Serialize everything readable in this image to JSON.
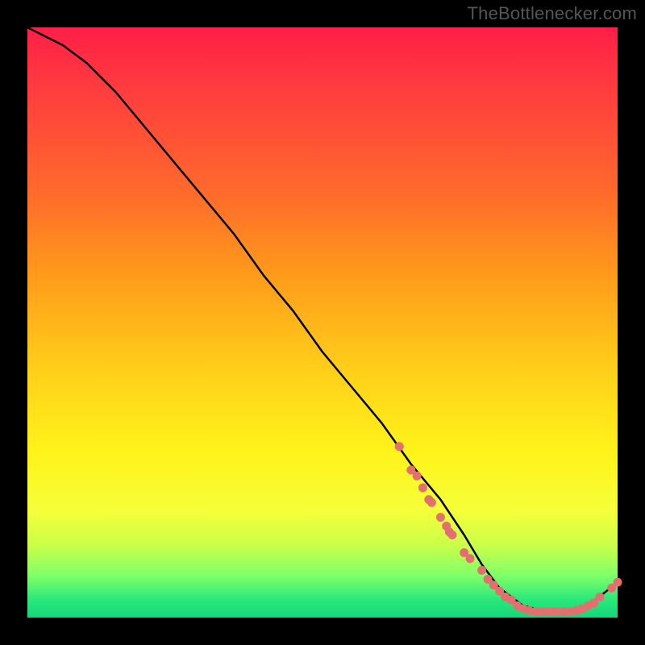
{
  "watermark": "TheBottlenecker.com",
  "chart_data": {
    "type": "line",
    "title": "",
    "xlabel": "",
    "ylabel": "",
    "xlim": [
      0,
      100
    ],
    "ylim": [
      0,
      100
    ],
    "series": [
      {
        "name": "curve",
        "x": [
          0,
          6,
          10,
          15,
          20,
          25,
          30,
          35,
          40,
          45,
          50,
          55,
          60,
          65,
          70,
          74,
          77,
          80,
          84,
          88,
          92,
          95,
          100
        ],
        "y": [
          100,
          97,
          94,
          89,
          83,
          77,
          71,
          65,
          58,
          52,
          45,
          39,
          33,
          26,
          20,
          14,
          9,
          5,
          2,
          1,
          1,
          2,
          6
        ]
      }
    ],
    "markers": {
      "name": "highlighted-points",
      "color": "#e36f6e",
      "x": [
        63,
        65,
        66,
        67,
        68,
        68.5,
        70,
        71,
        71.5,
        72,
        74,
        75,
        77,
        78,
        79,
        80,
        81,
        82,
        83,
        84,
        85,
        86,
        87,
        88,
        89,
        90,
        91,
        92,
        93,
        94,
        95,
        96,
        97,
        99,
        100
      ],
      "y": [
        29,
        25,
        24,
        22,
        20,
        19.5,
        17,
        15.5,
        14.5,
        14,
        11,
        10,
        8,
        6.5,
        5.5,
        4.5,
        3.5,
        3,
        2,
        1.5,
        1.2,
        1,
        1,
        1,
        1,
        1,
        1,
        1,
        1.2,
        1.5,
        2,
        2.5,
        3.5,
        5,
        6
      ]
    },
    "background_gradient": {
      "stops": [
        {
          "pos": 0,
          "color": "#ff1f47"
        },
        {
          "pos": 10,
          "color": "#ff3b3f"
        },
        {
          "pos": 28,
          "color": "#ff6a2b"
        },
        {
          "pos": 42,
          "color": "#ff9b1a"
        },
        {
          "pos": 58,
          "color": "#ffcf1a"
        },
        {
          "pos": 72,
          "color": "#fff31a"
        },
        {
          "pos": 82,
          "color": "#f5ff3a"
        },
        {
          "pos": 88,
          "color": "#c7ff4a"
        },
        {
          "pos": 93,
          "color": "#7dff6a"
        },
        {
          "pos": 97,
          "color": "#28e87a"
        },
        {
          "pos": 100,
          "color": "#17d67a"
        }
      ]
    }
  }
}
